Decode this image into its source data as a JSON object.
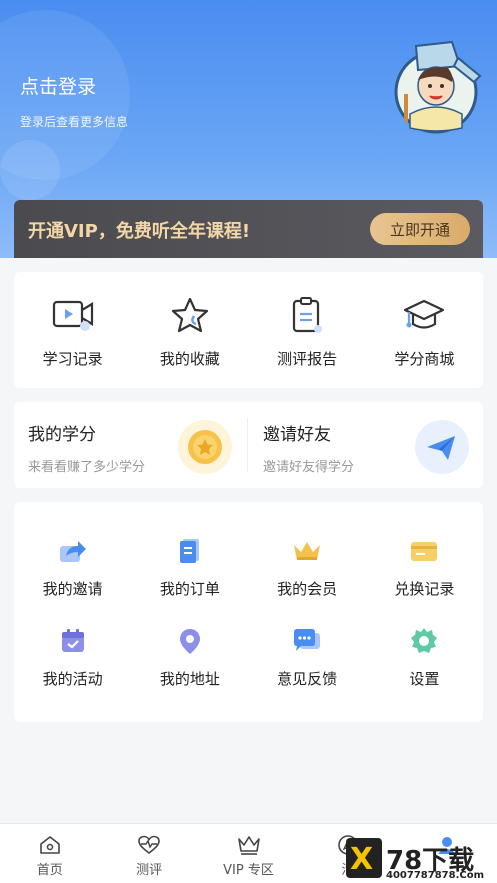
{
  "header": {
    "login_title": "点击登录",
    "login_subtitle": "登录后查看更多信息"
  },
  "vip": {
    "promo_text": "开通VIP，免费听全年课程!",
    "button_label": "立即开通"
  },
  "quick_links": [
    {
      "label": "学习记录",
      "icon": "video-record-icon"
    },
    {
      "label": "我的收藏",
      "icon": "star-icon"
    },
    {
      "label": "测评报告",
      "icon": "clipboard-icon"
    },
    {
      "label": "学分商城",
      "icon": "graduation-cap-icon"
    }
  ],
  "credits": {
    "title": "我的学分",
    "subtitle": "来看看赚了多少学分",
    "icon": "coin-icon"
  },
  "invite": {
    "title": "邀请好友",
    "subtitle": "邀请好友得学分",
    "icon": "paper-plane-icon"
  },
  "services": [
    {
      "label": "我的邀请",
      "icon": "share-icon"
    },
    {
      "label": "我的订单",
      "icon": "order-icon"
    },
    {
      "label": "我的会员",
      "icon": "crown-icon"
    },
    {
      "label": "兑换记录",
      "icon": "card-icon"
    },
    {
      "label": "我的活动",
      "icon": "calendar-icon"
    },
    {
      "label": "我的地址",
      "icon": "location-icon"
    },
    {
      "label": "意见反馈",
      "icon": "chat-icon"
    },
    {
      "label": "设置",
      "icon": "gear-icon"
    }
  ],
  "tabbar": [
    {
      "label": "首页",
      "icon": "home-icon"
    },
    {
      "label": "测评",
      "icon": "heartbeat-icon"
    },
    {
      "label": "VIP 专区",
      "icon": "crown-icon"
    },
    {
      "label": "活",
      "icon": "compass-icon"
    },
    {
      "label": "",
      "icon": "user-icon"
    }
  ],
  "watermark": {
    "title": "78下载",
    "url": "4007787878.Com"
  },
  "colors": {
    "brand_blue": "#4a8df0",
    "vip_gold": "#d9ab6b",
    "vip_dark": "#4a4a4f"
  }
}
